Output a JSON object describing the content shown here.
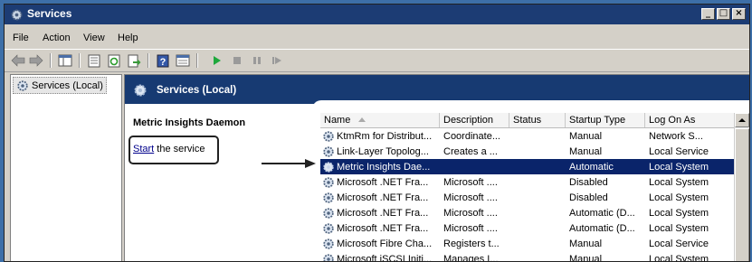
{
  "window": {
    "title": "Services",
    "icon": "gear-icon",
    "buttons": [
      "minimize",
      "maximize",
      "close"
    ]
  },
  "menu": [
    "File",
    "Action",
    "View",
    "Help"
  ],
  "toolbar": [
    "back-icon",
    "forward-icon",
    "show-hide-tree-icon",
    "properties-icon",
    "refresh-icon",
    "export-icon",
    "help-icon",
    "console-icon",
    "start-service-icon",
    "stop-service-icon",
    "pause-service-icon",
    "resume-service-icon"
  ],
  "tree": {
    "root": "Services (Local)"
  },
  "panel": {
    "header": "Services (Local)",
    "description_title": "Metric Insights Daemon",
    "start_link": "Start",
    "start_rest": " the service"
  },
  "table": {
    "columns": [
      "Name",
      "Description",
      "Status",
      "Startup Type",
      "Log On As"
    ],
    "rows": [
      {
        "name": "KtmRm for Distribut...",
        "description": "Coordinate...",
        "status": "",
        "startup": "Manual",
        "logon": "Network S...",
        "selected": false
      },
      {
        "name": "Link-Layer Topolog...",
        "description": "Creates a ...",
        "status": "",
        "startup": "Manual",
        "logon": "Local Service",
        "selected": false
      },
      {
        "name": "Metric Insights Dae...",
        "description": "",
        "status": "",
        "startup": "Automatic",
        "logon": "Local System",
        "selected": true
      },
      {
        "name": "Microsoft .NET Fra...",
        "description": "Microsoft ....",
        "status": "",
        "startup": "Disabled",
        "logon": "Local System",
        "selected": false
      },
      {
        "name": "Microsoft .NET Fra...",
        "description": "Microsoft ....",
        "status": "",
        "startup": "Disabled",
        "logon": "Local System",
        "selected": false
      },
      {
        "name": "Microsoft .NET Fra...",
        "description": "Microsoft ....",
        "status": "",
        "startup": "Automatic (D...",
        "logon": "Local System",
        "selected": false
      },
      {
        "name": "Microsoft .NET Fra...",
        "description": "Microsoft ....",
        "status": "",
        "startup": "Automatic (D...",
        "logon": "Local System",
        "selected": false
      },
      {
        "name": "Microsoft Fibre Cha...",
        "description": "Registers t...",
        "status": "",
        "startup": "Manual",
        "logon": "Local Service",
        "selected": false
      },
      {
        "name": "Microsoft iSCSI Initi...",
        "description": "Manages I...",
        "status": "",
        "startup": "Manual",
        "logon": "Local System",
        "selected": false
      }
    ]
  }
}
